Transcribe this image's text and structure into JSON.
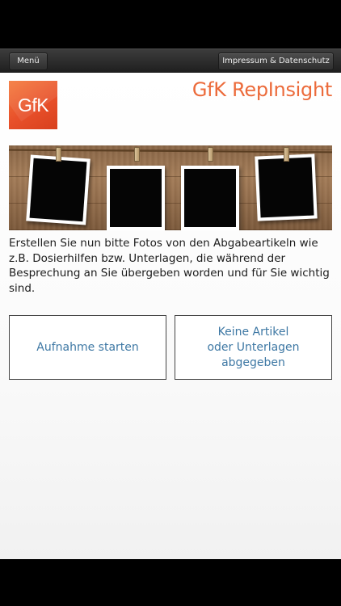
{
  "nav": {
    "menu_label": "Menü",
    "impressum_label": "Impressum & Datenschutz"
  },
  "header": {
    "logo_text": "GfK",
    "brand_title": "GfK RepInsight"
  },
  "main": {
    "description": "Erstellen Sie nun bitte Fotos von den Abgabeartikeln wie z.B. Dosierhilfen bzw. Unterlagen, die während der Besprechung an Sie übergeben worden und für Sie wichtig sind.",
    "start_button": "Aufnahme starten",
    "none_button_lines": [
      "Keine Artikel",
      "oder Unterlagen",
      "abgegeben"
    ]
  },
  "colors": {
    "accent": "#ec6b3b",
    "button_text": "#3e78a4"
  }
}
